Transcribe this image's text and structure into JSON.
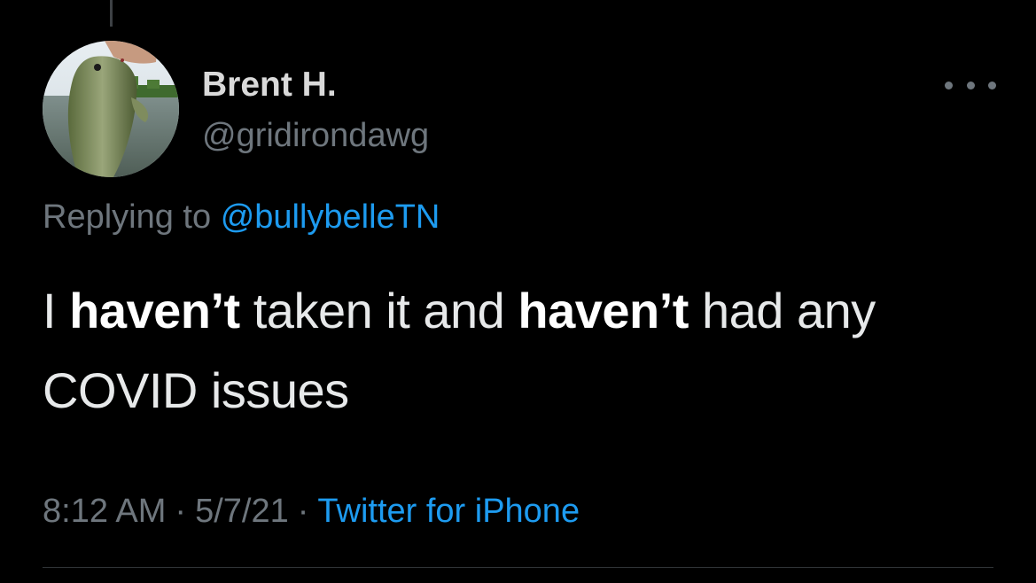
{
  "tweet": {
    "author": {
      "display_name": "Brent H.",
      "handle": "@gridirondawg",
      "avatar_icon": "fish-photo-avatar"
    },
    "more_icon": "more-options-icon",
    "reply": {
      "prefix": "Replying to",
      "mention": "@bullybelleTN"
    },
    "text": {
      "part1": "I ",
      "bold1": "haven’t",
      "part2": " taken it and ",
      "bold2": "haven’t",
      "part3": " had any COVID issues"
    },
    "meta": {
      "time": "8:12 AM",
      "separator": "·",
      "date": "5/7/21",
      "source": "Twitter for iPhone"
    }
  },
  "colors": {
    "background": "#000000",
    "primary_text": "#e7e9ea",
    "secondary_text": "#6e767d",
    "link": "#1d9bf0"
  }
}
